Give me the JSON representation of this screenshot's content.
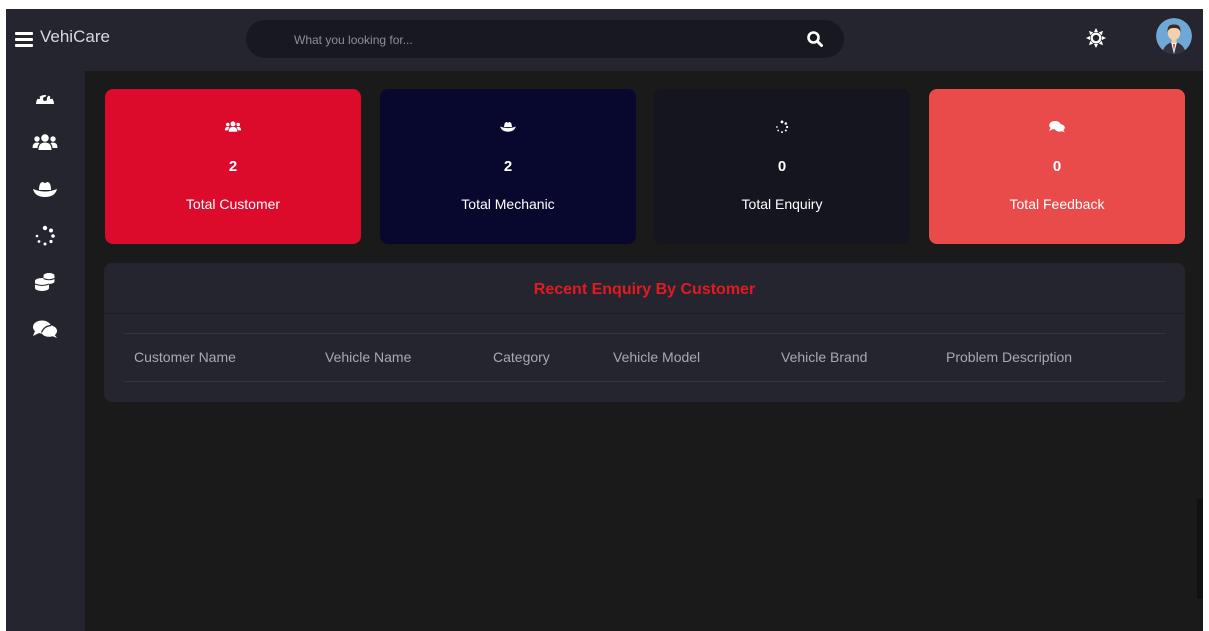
{
  "app": {
    "brand": "VehiCare"
  },
  "search": {
    "placeholder": "What you looking for..."
  },
  "colors": {
    "accent_red": "#e21a22",
    "topbar": "#24252e",
    "background": "#1a1a1b",
    "card_customer": "#dc0a2b",
    "card_mechanic": "#08072d",
    "card_enquiry": "#14151e",
    "card_feedback": "#e94b4b"
  },
  "sidebar": {
    "items": [
      {
        "name": "dashboard",
        "icon": "tachometer-icon"
      },
      {
        "name": "customers",
        "icon": "users-icon"
      },
      {
        "name": "mechanics",
        "icon": "hat-icon"
      },
      {
        "name": "enquiries",
        "icon": "spinner-icon"
      },
      {
        "name": "payments",
        "icon": "coins-icon"
      },
      {
        "name": "feedback",
        "icon": "comments-icon"
      }
    ]
  },
  "cards": [
    {
      "key": "customer",
      "value": "2",
      "label": "Total Customer",
      "icon": "users-icon"
    },
    {
      "key": "mechanic",
      "value": "2",
      "label": "Total Mechanic",
      "icon": "hat-icon"
    },
    {
      "key": "enquiry",
      "value": "0",
      "label": "Total Enquiry",
      "icon": "spinner-icon"
    },
    {
      "key": "feedback",
      "value": "0",
      "label": "Total Feedback",
      "icon": "comments-icon"
    }
  ],
  "recent": {
    "title": "Recent Enquiry By Customer",
    "columns": [
      "Customer Name",
      "Vehicle Name",
      "Category",
      "Vehicle Model",
      "Vehicle Brand",
      "Problem Description"
    ]
  }
}
